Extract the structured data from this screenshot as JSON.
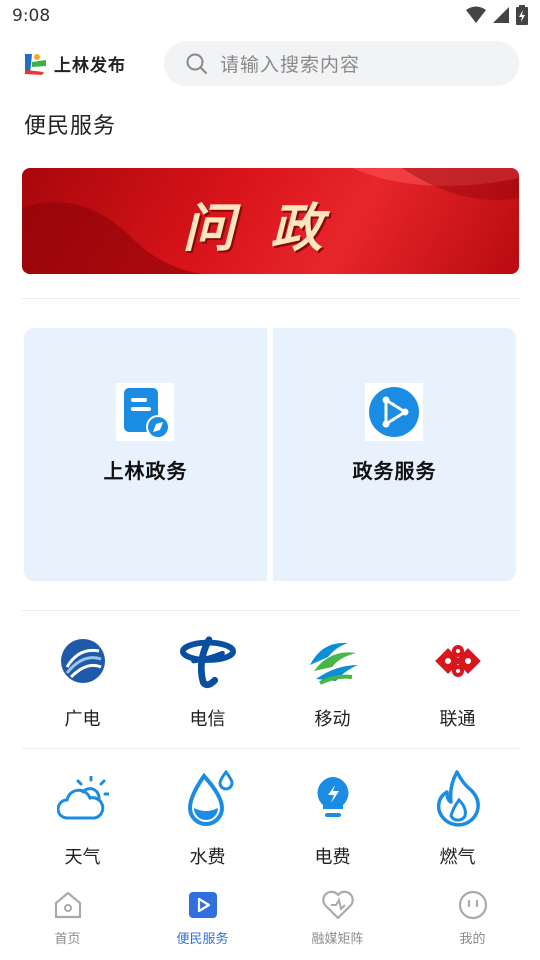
{
  "status_bar": {
    "time": "9:08"
  },
  "header": {
    "logo_text": "上林发布",
    "search_placeholder": "请输入搜索内容"
  },
  "page": {
    "title": "便民服务"
  },
  "banner": {
    "text": "问政"
  },
  "cards": [
    {
      "label": "上林政务",
      "icon": "document-compass-icon"
    },
    {
      "label": "政务服务",
      "icon": "share-nodes-icon"
    }
  ],
  "telecom": [
    {
      "label": "广电",
      "icon": "broadcast-logo-icon"
    },
    {
      "label": "电信",
      "icon": "telecom-logo-icon"
    },
    {
      "label": "移动",
      "icon": "mobile-logo-icon"
    },
    {
      "label": "联通",
      "icon": "unicom-logo-icon"
    }
  ],
  "utilities": [
    {
      "label": "天气",
      "icon": "weather-icon"
    },
    {
      "label": "水费",
      "icon": "water-drop-icon"
    },
    {
      "label": "电费",
      "icon": "lightbulb-icon"
    },
    {
      "label": "燃气",
      "icon": "flame-icon"
    }
  ],
  "tabs": [
    {
      "label": "首页",
      "icon": "home-icon",
      "active": false
    },
    {
      "label": "便民服务",
      "icon": "play-square-icon",
      "active": true
    },
    {
      "label": "融媒矩阵",
      "icon": "heart-icon",
      "active": false
    },
    {
      "label": "我的",
      "icon": "smile-icon",
      "active": false
    }
  ],
  "colors": {
    "accent": "#2f6fde",
    "card_bg": "#e8f2fc",
    "banner_red": "#d8141a"
  }
}
